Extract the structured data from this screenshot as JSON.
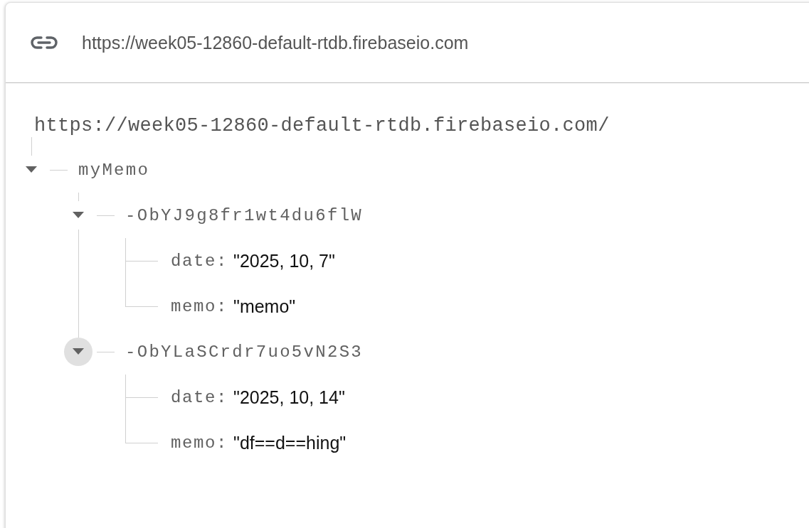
{
  "header": {
    "url": "https://week05-12860-default-rtdb.firebaseio.com"
  },
  "root": "https://week05-12860-default-rtdb.firebaseio.com/",
  "tree": [
    {
      "key": "myMemo",
      "expanded": true,
      "highlighted": false,
      "children": [
        {
          "key": "-ObYJ9g8fr1wt4du6flW",
          "expanded": true,
          "highlighted": false,
          "children": [
            {
              "key": "date:",
              "value": "\"2025, 10, 7\""
            },
            {
              "key": "memo:",
              "value": "\"memo\""
            }
          ]
        },
        {
          "key": "-ObYLaSCrdr7uo5vN2S3",
          "expanded": true,
          "highlighted": true,
          "children": [
            {
              "key": "date:",
              "value": "\"2025, 10, 14\""
            },
            {
              "key": "memo:",
              "value": "\"df==d==hing\""
            }
          ]
        }
      ]
    }
  ]
}
